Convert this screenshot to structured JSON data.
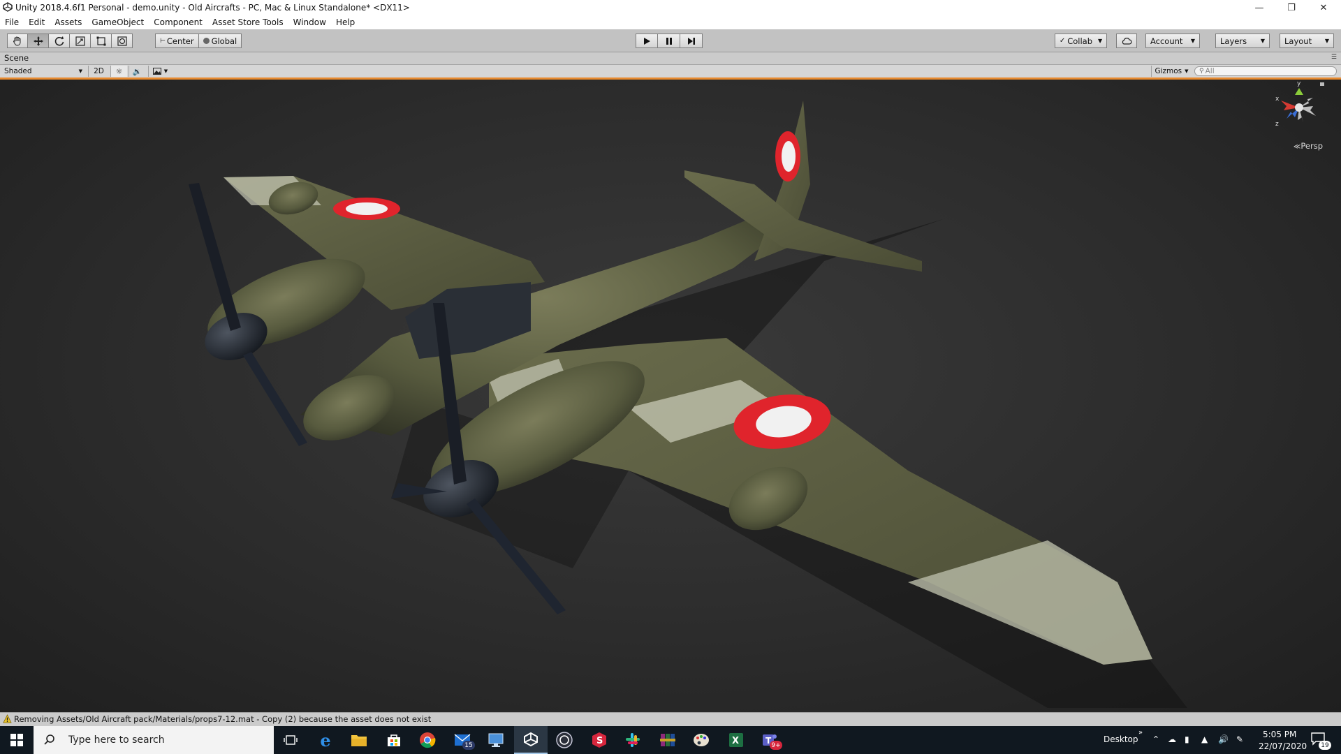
{
  "window": {
    "title": "Unity 2018.4.6f1 Personal - demo.unity - Old Aircrafts - PC, Mac & Linux Standalone* <DX11>"
  },
  "menu": [
    "File",
    "Edit",
    "Assets",
    "GameObject",
    "Component",
    "Asset Store Tools",
    "Window",
    "Help"
  ],
  "toolbar": {
    "pivot_mode": "Center",
    "pivot_rotation": "Global",
    "collab": "Collab",
    "account": "Account",
    "layers": "Layers",
    "layout": "Layout"
  },
  "scene": {
    "tab_label": "Scene",
    "draw_mode": "Shaded",
    "mode_2d": "2D",
    "gizmos": "Gizmos",
    "search_placeholder": "All",
    "projection": "Persp",
    "axis_y": "y",
    "axis_x": "x",
    "axis_z": "z"
  },
  "status": {
    "message": "Removing Assets/Old Aircraft pack/Materials/props7-12.mat - Copy (2) because the asset does not exist"
  },
  "taskbar": {
    "search_placeholder": "Type here to search",
    "mail_badge": "15",
    "teams_badge": "9+",
    "desktop_label": "Desktop",
    "time": "5:05 PM",
    "date": "22/07/2020",
    "notification_count": "19"
  },
  "colors": {
    "accent_orange": "#e78a2f",
    "taskbar_bg": "#101820",
    "camo_green": "#5d6042",
    "roundel_red": "#e0242c"
  }
}
